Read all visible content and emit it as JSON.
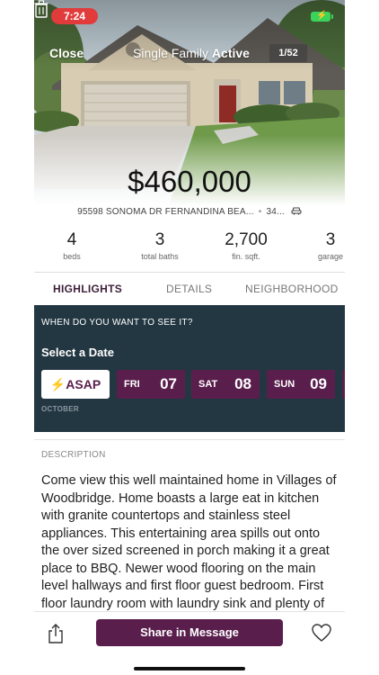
{
  "status": {
    "time": "7:24"
  },
  "header": {
    "close_label": "Close",
    "type": "Single Family",
    "status": "Active",
    "photo_counter": "1/52"
  },
  "listing": {
    "price": "$460,000",
    "address": "95598 SONOMA DR FERNANDINA BEA...",
    "address_extra": "34...",
    "stats": [
      {
        "value": "4",
        "label": "beds"
      },
      {
        "value": "3",
        "label": "total baths"
      },
      {
        "value": "2,700",
        "label": "fin. sqft."
      },
      {
        "value": "3",
        "label": "garage"
      }
    ]
  },
  "tabs": [
    "HIGHLIGHTS",
    "DETAILS",
    "NEIGHBORHOOD"
  ],
  "schedule": {
    "question": "WHEN DO YOU WANT TO SEE IT?",
    "heading": "Select a Date",
    "asap_label": "ASAP",
    "month": "OCTOBER",
    "days": [
      {
        "name": "FRI",
        "date": "07"
      },
      {
        "name": "SAT",
        "date": "08"
      },
      {
        "name": "SUN",
        "date": "09"
      }
    ]
  },
  "description": {
    "label": "DESCRIPTION",
    "text": "Come view this well maintained home in Villages of Woodbridge. Home boasts a large eat in kitchen with granite countertops and stainless steel appliances. This entertaining area spills out onto the over sized screened in porch making it a great place to BBQ. Newer wood flooring on the main level hallways and first floor guest bedroom. First floor laundry room with laundry sink and plenty of"
  },
  "bottom": {
    "share_label": "Share in Message"
  },
  "colors": {
    "brand": "#5a1e4d",
    "panel": "#233742",
    "alert": "#e23b3b"
  }
}
